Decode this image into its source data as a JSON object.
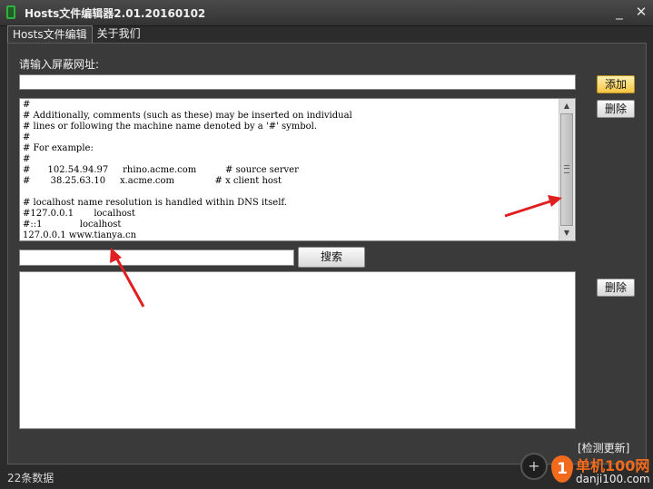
{
  "window": {
    "title": "Hosts文件编辑器2.01.20160102",
    "minimize": "_",
    "close": "✕"
  },
  "tabs": [
    {
      "label": "Hosts文件编辑",
      "active": true
    },
    {
      "label": "关于我们",
      "active": false
    }
  ],
  "editor": {
    "url_label": "请输入屏蔽网址:",
    "url_value": "",
    "add_button": "添加",
    "delete_button": "删除",
    "hosts_content": "#\n# Additionally, comments (such as these) may be inserted on individual\n# lines or following the machine name denoted by a '#' symbol.\n#\n# For example:\n#\n#      102.54.94.97     rhino.acme.com          # source server\n#       38.25.63.10     x.acme.com              # x client host\n\n# localhost name resolution is handled within DNS itself.\n#127.0.0.1       localhost\n#::1             localhost\n127.0.0.1 www.tianya.cn",
    "search_value": "",
    "search_button": "搜索",
    "results_delete_button": "删除",
    "update_link": "[检测更新]"
  },
  "status": {
    "text": "22条数据"
  },
  "watermark": {
    "badge": "1",
    "cn": "单机100网",
    "url": "danji100.com"
  },
  "colors": {
    "accent_add": "#f5c542",
    "annotation_arrow": "#e02020",
    "watermark": "#f26b1d"
  }
}
